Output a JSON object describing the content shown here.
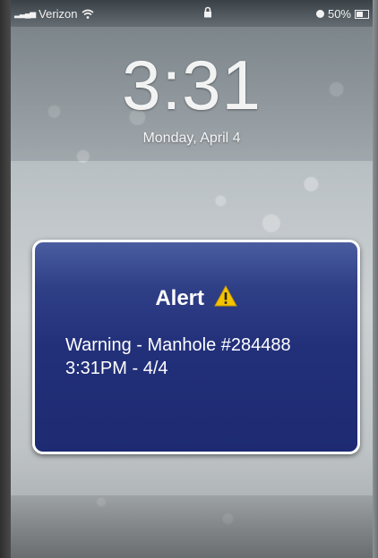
{
  "status_bar": {
    "carrier": "Verizon",
    "battery_percent": "50%",
    "icons": [
      "signal-icon",
      "wifi-icon",
      "lock-icon",
      "alarm-icon",
      "battery-icon"
    ]
  },
  "lock_screen": {
    "time": "3:31",
    "date": "Monday, April 4"
  },
  "alert": {
    "title": "Alert",
    "icon": "warning-icon",
    "line1": "Warning - Manhole #284488",
    "line2": "3:31PM - 4/4",
    "colors": {
      "background": "#22307a",
      "border": "#ffffff",
      "warning": "#f5c400"
    }
  }
}
